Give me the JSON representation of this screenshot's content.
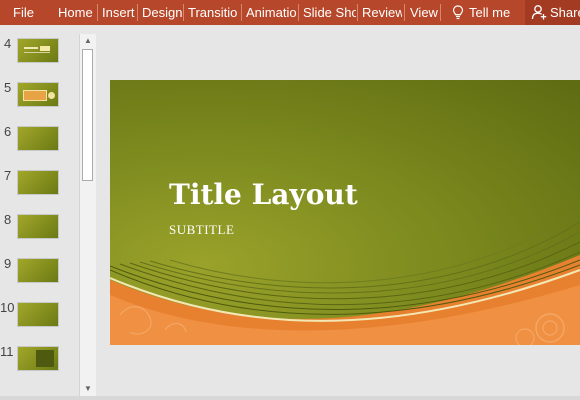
{
  "ribbon": {
    "tabs": [
      "File",
      "Home",
      "Insert",
      "Design",
      "Transitio",
      "Animatio",
      "Slide Sho",
      "Review",
      "View"
    ],
    "tell_me": "Tell me",
    "share": "Share"
  },
  "thumbnails": {
    "numbers": [
      "4",
      "5",
      "6",
      "7",
      "8",
      "9",
      "10",
      "11"
    ]
  },
  "slide": {
    "title": "Title Layout",
    "subtitle": "SUBTITLE"
  },
  "colors": {
    "ribbon": "#b7472a",
    "slide_green": "#7c8a1e",
    "slide_orange": "#e8812f"
  }
}
